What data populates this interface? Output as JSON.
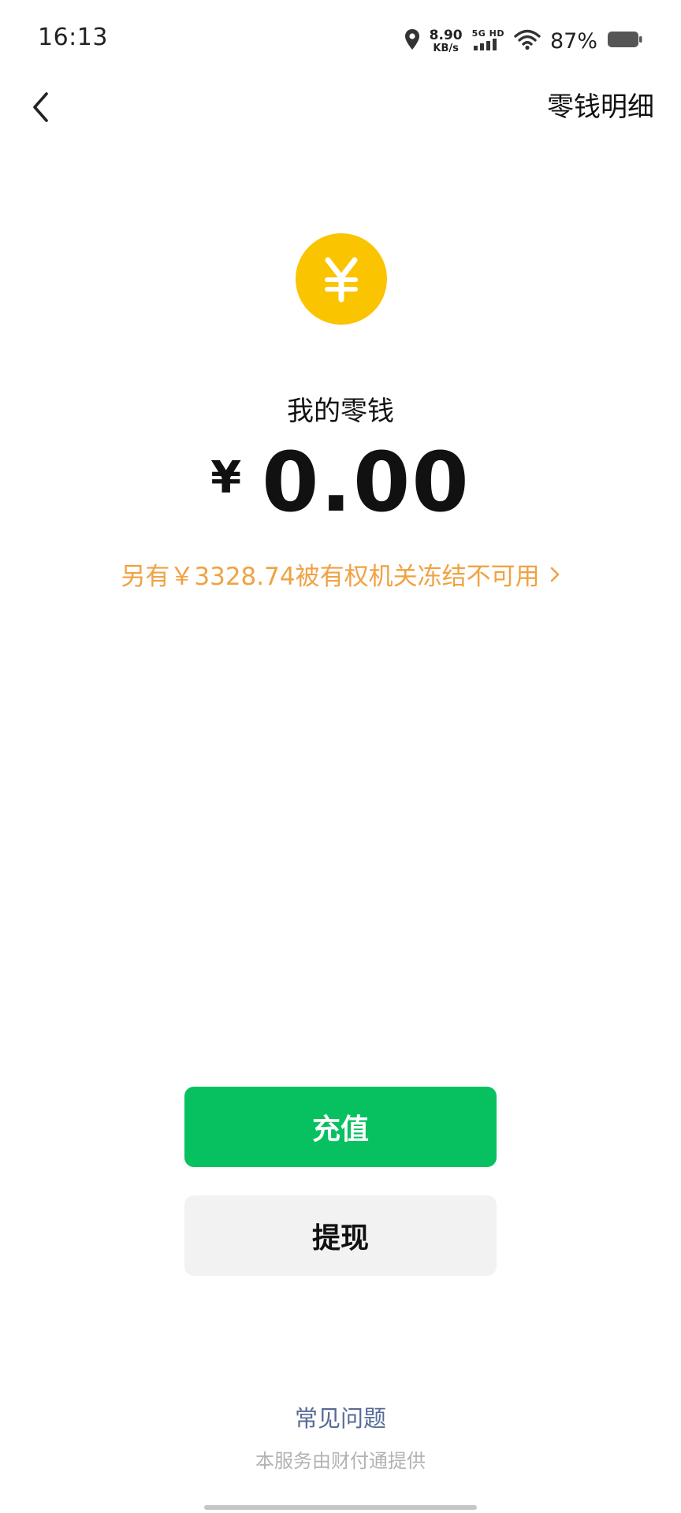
{
  "status_bar": {
    "time": "16:13",
    "net_rate": "8.90",
    "net_unit": "KB/s",
    "net_type": "5G HD",
    "battery": "87%"
  },
  "nav": {
    "details_link": "零钱明细"
  },
  "wallet": {
    "label": "我的零钱",
    "currency": "¥",
    "amount": "0.00",
    "frozen_notice": "另有￥3328.74被有权机关冻结不可用"
  },
  "actions": {
    "topup_label": "充值",
    "withdraw_label": "提现"
  },
  "footer": {
    "faq_link": "常见问题",
    "provider": "本服务由财付通提供"
  },
  "icons": {
    "back": "chevron-left-icon",
    "coin": "yuan-coin-icon",
    "frozen_chevron": "chevron-right-icon",
    "location": "location-pin-icon",
    "signal": "signal-bars-icon",
    "wifi": "wifi-icon",
    "battery": "battery-icon"
  },
  "colors": {
    "primary_green": "#07c160",
    "coin_yellow": "#fbc400",
    "warning_orange": "#f0a243",
    "link_blue": "#576b95"
  }
}
